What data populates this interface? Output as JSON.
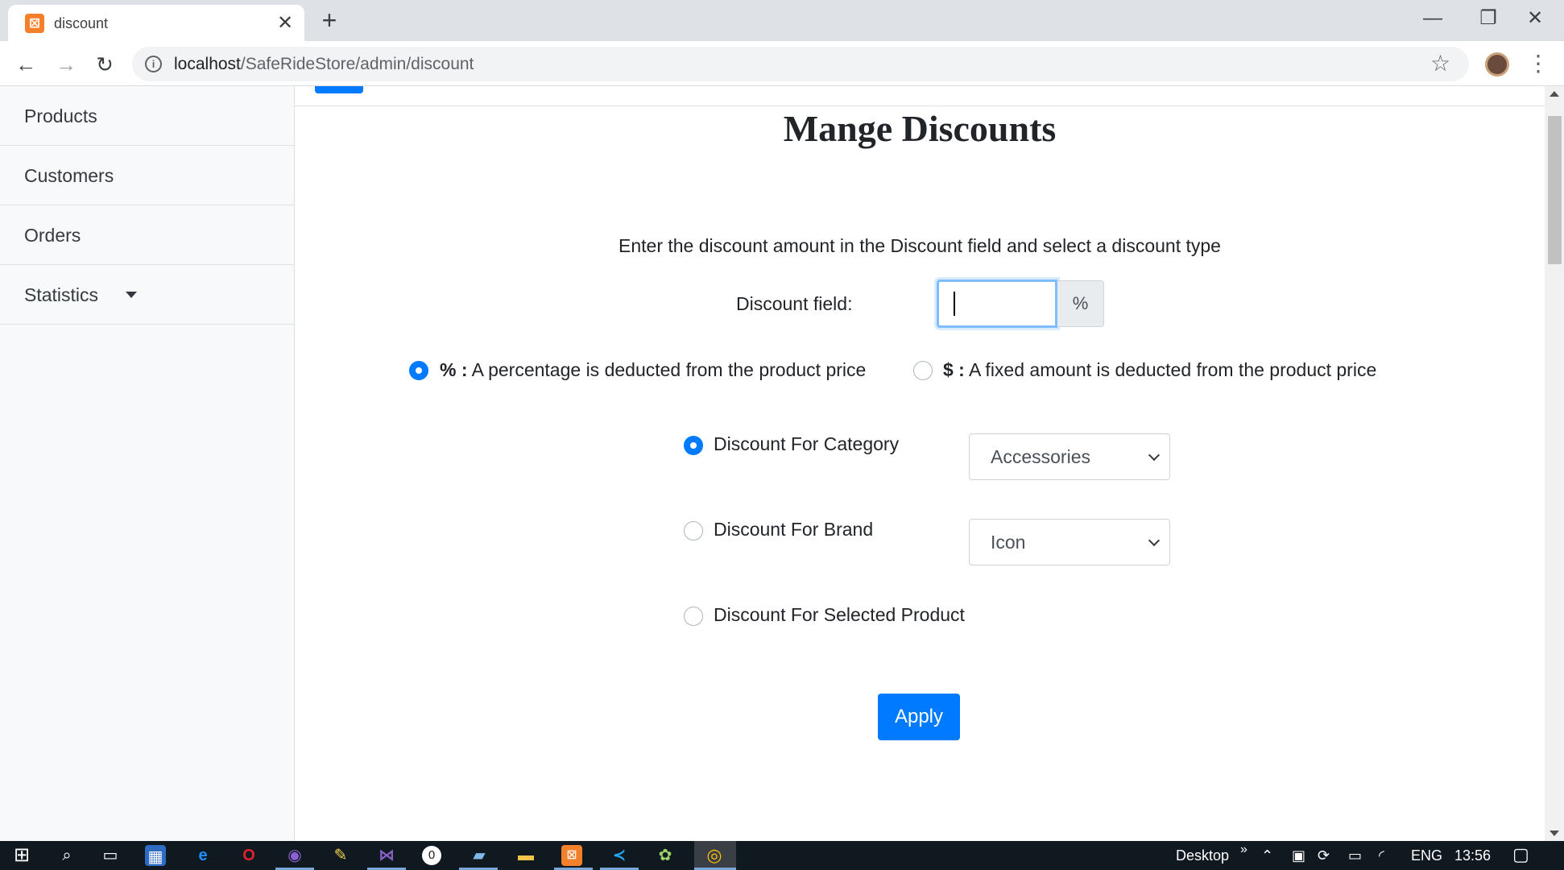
{
  "browser": {
    "tab_title": "discount",
    "tab_close": "✕",
    "new_tab": "+",
    "url_host": "localhost",
    "url_path": "/SafeRideStore/admin/discount",
    "window_minimize": "—",
    "window_restore": "❐",
    "window_close": "✕"
  },
  "sidebar": {
    "items": [
      {
        "label": "Products"
      },
      {
        "label": "Customers"
      },
      {
        "label": "Orders"
      },
      {
        "label": "Statistics"
      }
    ]
  },
  "main": {
    "title": "Mange Discounts",
    "instructions": "Enter the discount amount in the Discount field and select a discount type",
    "discount_label": "Discount field:",
    "discount_value": "",
    "discount_addon": "%",
    "type_options": [
      {
        "symbol": "% :",
        "text": " A percentage is deducted from the product price",
        "checked": true
      },
      {
        "symbol": "$ :",
        "text": " A fixed amount is deducted from the product price",
        "checked": false
      }
    ],
    "scope_options": [
      {
        "label": "Discount For Category",
        "checked": true,
        "select_value": "Accessories"
      },
      {
        "label": "Discount For Brand",
        "checked": false,
        "select_value": "Icon"
      },
      {
        "label": "Discount For Selected Product",
        "checked": false
      }
    ],
    "apply_label": "Apply"
  },
  "taskbar": {
    "desktop_label": "Desktop",
    "chevron": "»",
    "language": "ENG",
    "time": "13:56"
  },
  "colors": {
    "primary": "#007bff",
    "sidebar_bg": "#f8f9fa",
    "taskbar_bg": "#101820"
  }
}
